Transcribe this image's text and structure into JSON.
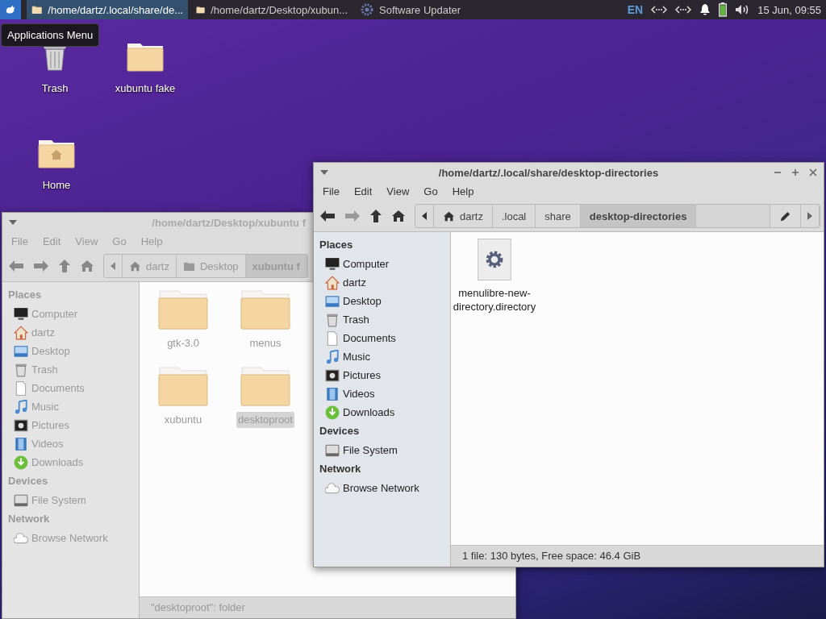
{
  "panel": {
    "tasks": [
      {
        "label": "/home/dartz/.local/share/de...",
        "kind": "folder",
        "selected": true
      },
      {
        "label": "/home/dartz/Desktop/xubun...",
        "kind": "folder",
        "selected": false
      },
      {
        "label": "Software Updater",
        "kind": "updater",
        "selected": false
      }
    ],
    "keyboard_layout": "EN",
    "clock": "15 Jun, 09:55"
  },
  "tooltip": "Applications Menu",
  "desktop_icons": [
    {
      "label": "Trash",
      "kind": "trash"
    },
    {
      "label": "xubuntu fake",
      "kind": "folder"
    },
    {
      "label": "Home",
      "kind": "home"
    }
  ],
  "windows": [
    {
      "title": "/home/dartz/Desktop/xubuntu f",
      "active": false,
      "menu": [
        "File",
        "Edit",
        "View",
        "Go",
        "Help"
      ],
      "path": [
        {
          "label": "dartz",
          "kind": "home",
          "selected": false
        },
        {
          "label": "Desktop",
          "kind": "folder",
          "selected": false
        },
        {
          "label": "xubuntu f",
          "kind": "plain",
          "selected": true
        }
      ],
      "sidebar": [
        {
          "heading": "Places",
          "items": [
            {
              "label": "Computer",
              "kind": "computer"
            },
            {
              "label": "dartz",
              "kind": "home"
            },
            {
              "label": "Desktop",
              "kind": "desktop"
            },
            {
              "label": "Trash",
              "kind": "trash"
            },
            {
              "label": "Documents",
              "kind": "document"
            },
            {
              "label": "Music",
              "kind": "music"
            },
            {
              "label": "Pictures",
              "kind": "pictures"
            },
            {
              "label": "Videos",
              "kind": "videos"
            },
            {
              "label": "Downloads",
              "kind": "downloads"
            }
          ]
        },
        {
          "heading": "Devices",
          "items": [
            {
              "label": "File System",
              "kind": "drive"
            }
          ]
        },
        {
          "heading": "Network",
          "items": [
            {
              "label": "Browse Network",
              "kind": "network"
            }
          ]
        }
      ],
      "files": [
        {
          "label": "gtk-3.0",
          "kind": "folder",
          "selected": false
        },
        {
          "label": "menus",
          "kind": "folder",
          "selected": false
        },
        {
          "label": "xubuntu",
          "kind": "folder",
          "selected": false
        },
        {
          "label": "desktoproot",
          "kind": "folder",
          "selected": true
        }
      ],
      "status": "\"desktoproot\": folder"
    },
    {
      "title": "/home/dartz/.local/share/desktop-directories",
      "active": true,
      "menu": [
        "File",
        "Edit",
        "View",
        "Go",
        "Help"
      ],
      "path": [
        {
          "label": "dartz",
          "kind": "home",
          "selected": false
        },
        {
          "label": ".local",
          "kind": "plain",
          "selected": false
        },
        {
          "label": "share",
          "kind": "plain",
          "selected": false
        },
        {
          "label": "desktop-directories",
          "kind": "plain",
          "selected": true
        }
      ],
      "sidebar": [
        {
          "heading": "Places",
          "items": [
            {
              "label": "Computer",
              "kind": "computer"
            },
            {
              "label": "dartz",
              "kind": "home"
            },
            {
              "label": "Desktop",
              "kind": "desktop"
            },
            {
              "label": "Trash",
              "kind": "trash"
            },
            {
              "label": "Documents",
              "kind": "document"
            },
            {
              "label": "Music",
              "kind": "music"
            },
            {
              "label": "Pictures",
              "kind": "pictures"
            },
            {
              "label": "Videos",
              "kind": "videos"
            },
            {
              "label": "Downloads",
              "kind": "downloads"
            }
          ]
        },
        {
          "heading": "Devices",
          "items": [
            {
              "label": "File System",
              "kind": "drive"
            }
          ]
        },
        {
          "heading": "Network",
          "items": [
            {
              "label": "Browse Network",
              "kind": "network"
            }
          ]
        }
      ],
      "files": [
        {
          "label": "menulibre-new-directory.directory",
          "kind": "settings",
          "selected": false
        }
      ],
      "status": "1 file: 130 bytes, Free space: 46.4 GiB"
    }
  ]
}
